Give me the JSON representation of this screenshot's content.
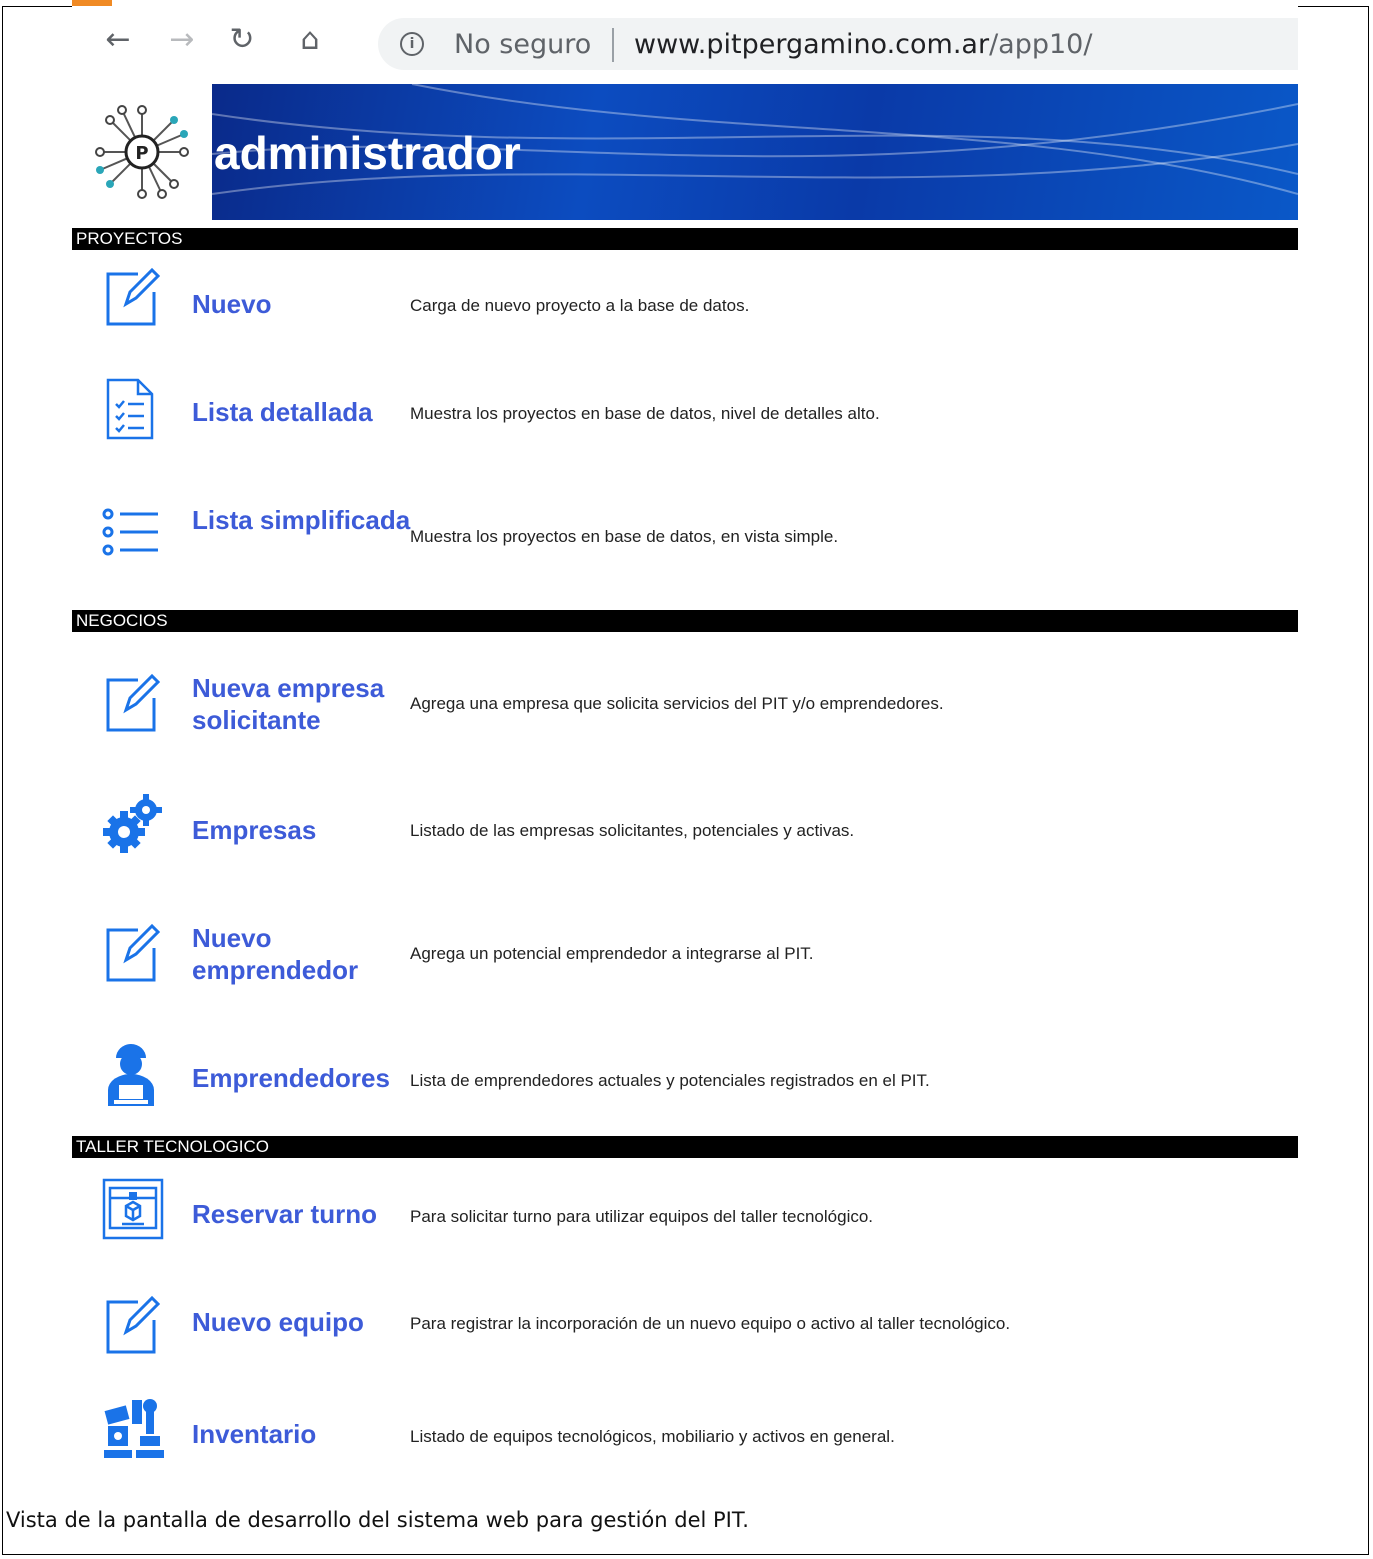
{
  "browser": {
    "security_label": "No seguro",
    "url_host": "www.pitpergamino.com.ar",
    "url_path": "/app10/"
  },
  "banner": {
    "title": "administrador"
  },
  "sections": [
    {
      "title": "PROYECTOS",
      "items": [
        {
          "label": "Nuevo",
          "description": "Carga de nuevo proyecto a la base de datos.",
          "icon": "edit-icon"
        },
        {
          "label": "Lista detallada",
          "description": "Muestra los proyectos en base de datos, nivel de detalles alto.",
          "icon": "checklist-document-icon"
        },
        {
          "label": "Lista simplificada",
          "description": "Muestra los proyectos en base de datos, en vista simple.",
          "icon": "bullet-list-icon"
        }
      ]
    },
    {
      "title": "NEGOCIOS",
      "items": [
        {
          "label": "Nueva empresa solicitante",
          "description": "Agrega una empresa que solicita servicios del PIT y/o emprendedores.",
          "icon": "edit-icon"
        },
        {
          "label": "Empresas",
          "description": "Listado de las empresas solicitantes, potenciales y activas.",
          "icon": "gears-icon"
        },
        {
          "label": "Nuevo emprendedor",
          "description": "Agrega un potencial emprendedor a integrarse al PIT.",
          "icon": "edit-icon"
        },
        {
          "label": "Emprendedores",
          "description": "Lista de emprendedores actuales y potenciales registrados en el PIT.",
          "icon": "user-laptop-icon"
        }
      ]
    },
    {
      "title": "TALLER TECNOLOGICO",
      "items": [
        {
          "label": "Reservar turno",
          "description": "Para solicitar turno para utilizar equipos del taller tecnológico.",
          "icon": "3d-printer-icon"
        },
        {
          "label": "Nuevo equipo",
          "description": "Para registrar la incorporación de un nuevo equipo o activo al taller tecnológico.",
          "icon": "edit-icon"
        },
        {
          "label": "Inventario",
          "description": "Listado de equipos tecnológicos, mobiliario y activos en general.",
          "icon": "robot-arm-icon"
        }
      ]
    }
  ],
  "caption": "Vista de la pantalla de desarrollo del sistema web para gestión del PIT."
}
